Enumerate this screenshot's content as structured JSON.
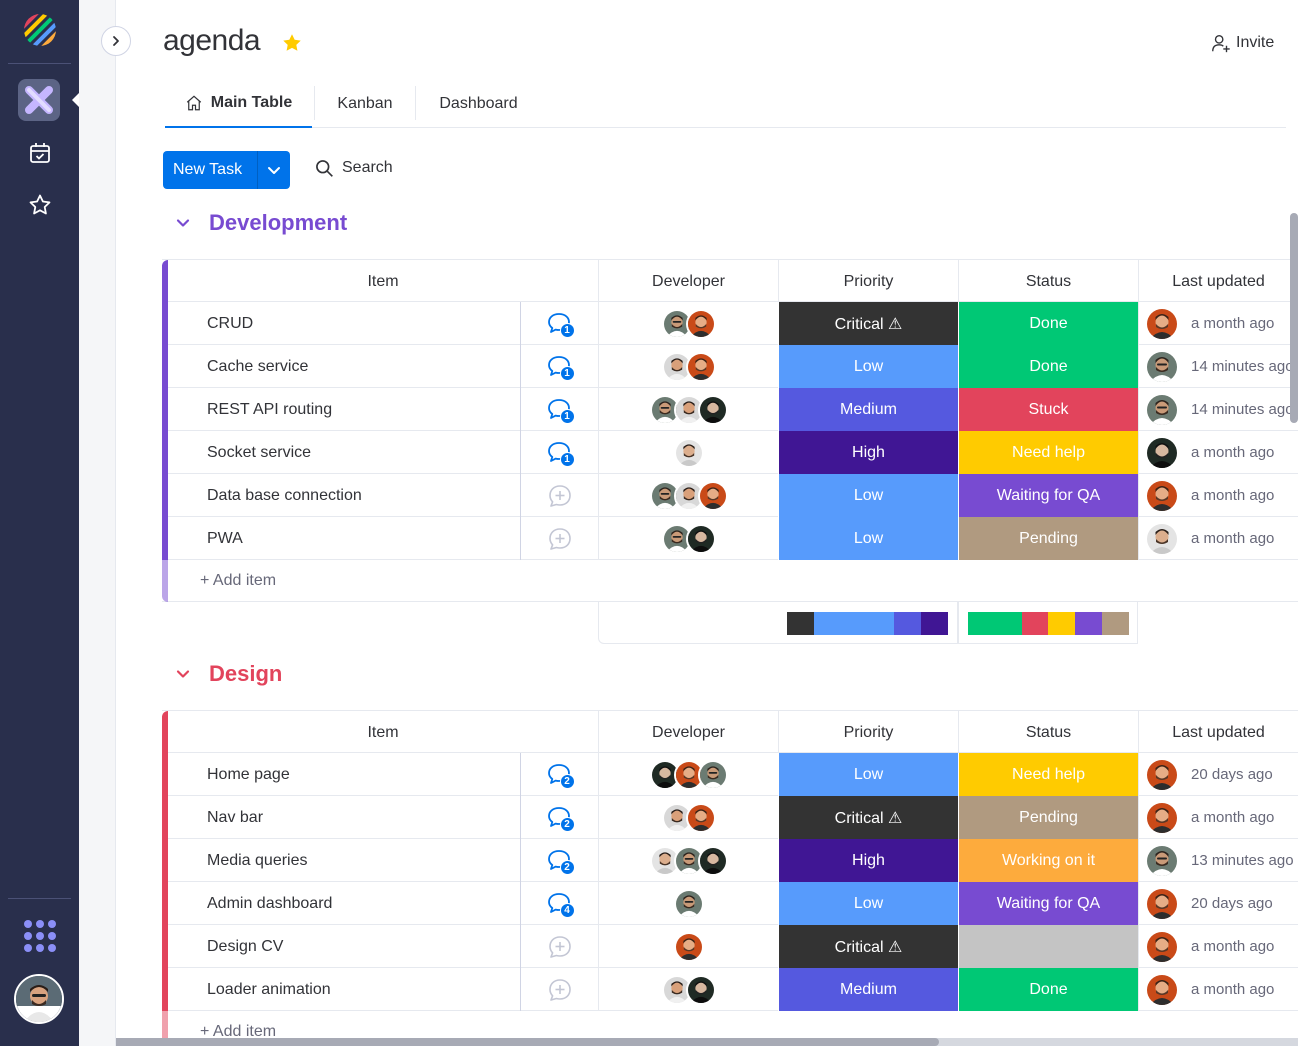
{
  "board": {
    "title": "agenda",
    "invite_label": "Invite",
    "tabs": [
      {
        "label": "Main Table",
        "active": true
      },
      {
        "label": "Kanban",
        "active": false
      },
      {
        "label": "Dashboard",
        "active": false
      }
    ],
    "new_task_label": "New Task",
    "search_label": "Search",
    "columns": {
      "item": "Item",
      "developer": "Developer",
      "priority": "Priority",
      "status": "Status",
      "last_updated": "Last updated"
    },
    "add_item_label": "+ Add item"
  },
  "colors": {
    "rail": "#292f4c",
    "accent": "#0073ea",
    "development": "#784bd1",
    "design": "#e2445c",
    "critical": "#333333",
    "low": "#579bfc",
    "medium": "#5559df",
    "high": "#401694",
    "done": "#00c875",
    "stuck": "#e2445c",
    "need_help": "#ffcb00",
    "waiting_qa": "#784bd1",
    "pending": "#b09a80",
    "working": "#fdab3d",
    "empty": "#c4c4c4"
  },
  "groups": [
    {
      "name": "Development",
      "color": "#784bd1",
      "rows": [
        {
          "name": "CRUD",
          "updates": "1",
          "devs": [
            "a1",
            "a2"
          ],
          "priority": "Critical ⚠",
          "priority_color": "#333333",
          "status": "Done",
          "status_color": "#00c875",
          "updated_by": "a2",
          "updated": "a month ago"
        },
        {
          "name": "Cache service",
          "updates": "1",
          "devs": [
            "a3",
            "a2"
          ],
          "priority": "Low",
          "priority_color": "#579bfc",
          "status": "Done",
          "status_color": "#00c875",
          "updated_by": "a1",
          "updated": "14 minutes ago"
        },
        {
          "name": "REST API routing",
          "updates": "1",
          "devs": [
            "a1",
            "a3",
            "a4"
          ],
          "priority": "Medium",
          "priority_color": "#5559df",
          "status": "Stuck",
          "status_color": "#e2445c",
          "updated_by": "a1",
          "updated": "14 minutes ago"
        },
        {
          "name": "Socket service",
          "updates": "1",
          "devs": [
            "a5"
          ],
          "priority": "High",
          "priority_color": "#401694",
          "status": "Need help",
          "status_color": "#ffcb00",
          "updated_by": "a4",
          "updated": "a month ago"
        },
        {
          "name": "Data base connection",
          "updates": "",
          "devs": [
            "a1",
            "a3",
            "a2"
          ],
          "priority": "Low",
          "priority_color": "#579bfc",
          "status": "Waiting for QA",
          "status_color": "#784bd1",
          "updated_by": "a2",
          "updated": "a month ago"
        },
        {
          "name": "PWA",
          "updates": "",
          "devs": [
            "a1",
            "a4"
          ],
          "priority": "Low",
          "priority_color": "#579bfc",
          "status": "Pending",
          "status_color": "#b09a80",
          "updated_by": "a5",
          "updated": "a month ago"
        }
      ],
      "priority_summary": [
        {
          "color": "#333333",
          "share": 1
        },
        {
          "color": "#579bfc",
          "share": 3
        },
        {
          "color": "#5559df",
          "share": 1
        },
        {
          "color": "#401694",
          "share": 1
        }
      ],
      "status_summary": [
        {
          "color": "#00c875",
          "share": 2
        },
        {
          "color": "#e2445c",
          "share": 1
        },
        {
          "color": "#ffcb00",
          "share": 1
        },
        {
          "color": "#784bd1",
          "share": 1
        },
        {
          "color": "#b09a80",
          "share": 1
        }
      ]
    },
    {
      "name": "Design",
      "color": "#e2445c",
      "rows": [
        {
          "name": "Home page",
          "updates": "2",
          "devs": [
            "a4",
            "a2",
            "a1"
          ],
          "priority": "Low",
          "priority_color": "#579bfc",
          "status": "Need help",
          "status_color": "#ffcb00",
          "updated_by": "a2",
          "updated": "20 days ago"
        },
        {
          "name": "Nav bar",
          "updates": "2",
          "devs": [
            "a3",
            "a2"
          ],
          "priority": "Critical ⚠",
          "priority_color": "#333333",
          "status": "Pending",
          "status_color": "#b09a80",
          "updated_by": "a2",
          "updated": "a month ago"
        },
        {
          "name": "Media queries",
          "updates": "2",
          "devs": [
            "a5",
            "a1",
            "a4"
          ],
          "priority": "High",
          "priority_color": "#401694",
          "status": "Working on it",
          "status_color": "#fdab3d",
          "updated_by": "a1",
          "updated": "13 minutes ago"
        },
        {
          "name": "Admin dashboard",
          "updates": "4",
          "devs": [
            "a1"
          ],
          "priority": "Low",
          "priority_color": "#579bfc",
          "status": "Waiting for QA",
          "status_color": "#784bd1",
          "updated_by": "a2",
          "updated": "20 days ago"
        },
        {
          "name": "Design CV",
          "updates": "",
          "devs": [
            "a2"
          ],
          "priority": "Critical ⚠",
          "priority_color": "#333333",
          "status": "",
          "status_color": "#c4c4c4",
          "updated_by": "a2",
          "updated": "a month ago"
        },
        {
          "name": "Loader animation",
          "updates": "",
          "devs": [
            "a3",
            "a4"
          ],
          "priority": "Medium",
          "priority_color": "#5559df",
          "status": "Done",
          "status_color": "#00c875",
          "updated_by": "a2",
          "updated": "a month ago"
        }
      ]
    }
  ]
}
